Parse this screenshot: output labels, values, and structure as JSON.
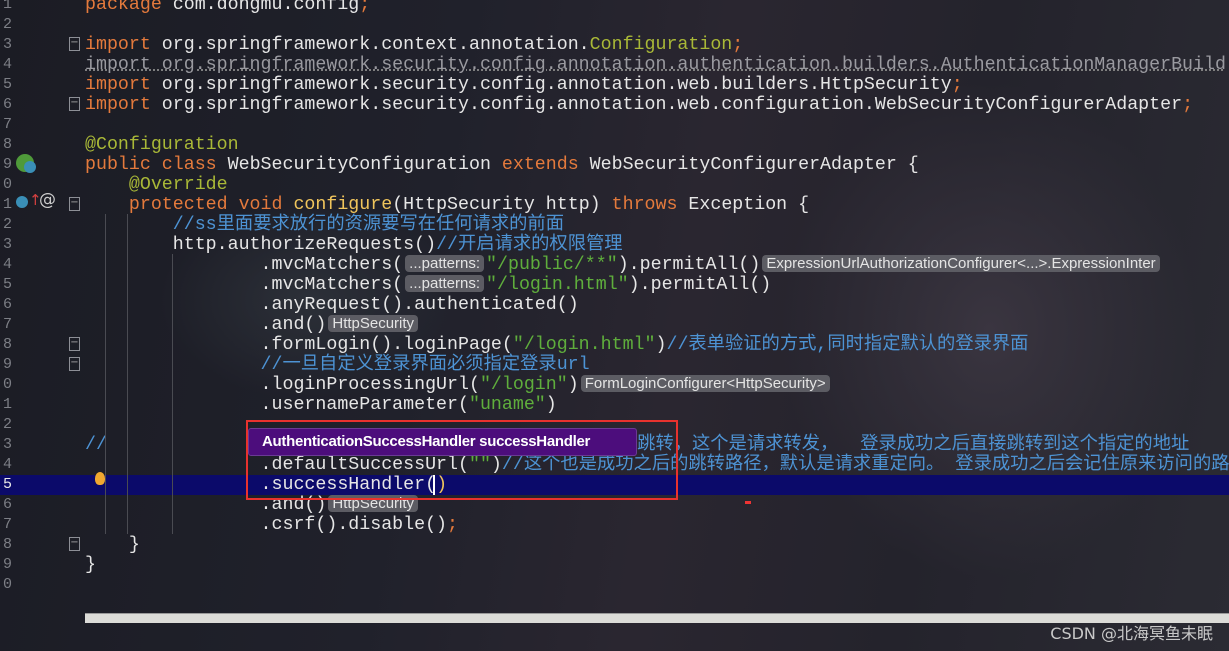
{
  "editor": {
    "current_line": 25,
    "lines": [
      {
        "n": "1",
        "t": [
          [
            "package ",
            "kw"
          ],
          [
            "com.dongmu.config",
            ""
          ],
          [
            ";",
            "kw"
          ]
        ]
      },
      {
        "n": "2",
        "t": []
      },
      {
        "n": "3",
        "t": [
          [
            "import ",
            "kw"
          ],
          [
            "org.springframework.context.annotation.",
            ""
          ],
          [
            "Configuration",
            "ann"
          ],
          [
            ";",
            "kw"
          ]
        ]
      },
      {
        "n": "4",
        "t": [
          [
            "import org.springframework.security.config.annotation.authentication.builders.AuthenticationManagerBuild",
            "dim"
          ]
        ]
      },
      {
        "n": "5",
        "t": [
          [
            "import ",
            "kw"
          ],
          [
            "org.springframework.security.config.annotation.web.builders.HttpSecurity",
            ""
          ],
          [
            ";",
            "kw"
          ]
        ]
      },
      {
        "n": "6",
        "t": [
          [
            "import ",
            "kw"
          ],
          [
            "org.springframework.security.config.annotation.web.configuration.WebSecurityConfigurerAdapter",
            ""
          ],
          [
            ";",
            "kw"
          ]
        ]
      },
      {
        "n": "7",
        "t": []
      },
      {
        "n": "8",
        "t": [
          [
            "@Configuration",
            "ann"
          ]
        ]
      },
      {
        "n": "9",
        "t": [
          [
            "public class ",
            "kw"
          ],
          [
            "WebSecurityConfiguration ",
            ""
          ],
          [
            "extends ",
            "kw"
          ],
          [
            "WebSecurityConfigurerAdapter {",
            ""
          ]
        ]
      },
      {
        "n": "0",
        "t": [
          [
            "    @Override",
            "ann"
          ]
        ]
      },
      {
        "n": "1",
        "t": [
          [
            "    protected void ",
            "kw"
          ],
          [
            "configure",
            "fn"
          ],
          [
            "(HttpSecurity http) ",
            ""
          ],
          [
            "throws ",
            "kw"
          ],
          [
            "Exception {",
            ""
          ]
        ]
      },
      {
        "n": "2",
        "t": [
          [
            "        //ss里面要求放行的资源要写在任何请求的前面",
            "cmt"
          ]
        ]
      },
      {
        "n": "3",
        "t": [
          [
            "        http.authorizeRequests()",
            ""
          ],
          [
            "//开启请求的权限管理",
            "cmt"
          ]
        ]
      },
      {
        "n": "4",
        "t": [
          [
            "                .mvcMatchers(",
            ""
          ],
          [
            "...patterns:",
            "hint"
          ],
          [
            "\"/public/**\"",
            "str"
          ],
          [
            ").permitAll()",
            ""
          ],
          [
            "ExpressionUrlAuthorizationConfigurer<...>.ExpressionInter",
            "hint"
          ]
        ]
      },
      {
        "n": "5",
        "t": [
          [
            "                .mvcMatchers(",
            ""
          ],
          [
            "...patterns:",
            "hint"
          ],
          [
            "\"/login.html\"",
            "str"
          ],
          [
            ").permitAll()",
            ""
          ]
        ]
      },
      {
        "n": "6",
        "t": [
          [
            "                .anyRequest().authenticated()",
            ""
          ]
        ]
      },
      {
        "n": "7",
        "t": [
          [
            "                .and()",
            ""
          ],
          [
            "HttpSecurity",
            "hint"
          ]
        ]
      },
      {
        "n": "8",
        "t": [
          [
            "                .formLogin().loginPage(",
            ""
          ],
          [
            "\"/login.html\"",
            "str"
          ],
          [
            ")",
            ""
          ],
          [
            "//表单验证的方式,同时指定默认的登录界面",
            "cmt"
          ]
        ]
      },
      {
        "n": "9",
        "t": [
          [
            "                //一旦自定义登录界面必须指定登录url",
            "cmt"
          ]
        ]
      },
      {
        "n": "0",
        "t": [
          [
            "                .loginProcessingUrl(",
            ""
          ],
          [
            "\"/login\"",
            "str"
          ],
          [
            ")",
            ""
          ],
          [
            "FormLoginConfigurer<HttpSecurity>",
            "hint"
          ]
        ]
      },
      {
        "n": "1",
        "t": [
          [
            "                .usernameParameter(",
            ""
          ],
          [
            "\"uname\"",
            "str"
          ],
          [
            ")",
            ""
          ]
        ]
      },
      {
        "n": "2",
        "t": []
      },
      {
        "n": "3",
        "t": [
          [
            "//",
            "cmt"
          ],
          [
            "                                        成功之后的跳转，这个是请求转发，  登录成功之后直接跳转到这个指定的地址",
            "cmt"
          ]
        ]
      },
      {
        "n": "4",
        "t": [
          [
            "                .defaultSuccessUrl(",
            ""
          ],
          [
            "\"\"",
            "str"
          ],
          [
            ")",
            ""
          ],
          [
            "//这个也是成功之后的跳转路径，默认是请求重定向。 登录成功之后会记住原来访问的路径",
            "cmt"
          ]
        ]
      },
      {
        "n": "5",
        "t": [
          [
            "                .successHandler(",
            ""
          ],
          [
            ")",
            "fn"
          ]
        ]
      },
      {
        "n": "6",
        "t": [
          [
            "                .and()",
            ""
          ],
          [
            "HttpSecurity",
            "hint"
          ]
        ]
      },
      {
        "n": "7",
        "t": [
          [
            "                .csrf().disable()",
            ""
          ],
          [
            ";",
            "kw"
          ]
        ]
      },
      {
        "n": "8",
        "t": [
          [
            "    }",
            ""
          ]
        ]
      },
      {
        "n": "9",
        "t": [
          [
            "}",
            ""
          ]
        ]
      },
      {
        "n": "0",
        "t": []
      }
    ]
  },
  "tooltip": {
    "text": "AuthenticationSuccessHandler successHandler"
  },
  "gutter_icons": {
    "line9": "spring-bean-icon",
    "line11_a": "override-method-icon",
    "line11_b": "at-annotation-icon",
    "line25": "lightbulb-intention-icon"
  },
  "watermark": "CSDN @北海冥鱼未眠",
  "colors": {
    "keyword": "#e47a3c",
    "annotation": "#a9b837",
    "string": "#5fae3c",
    "comment": "#4d93d4",
    "current_line": "#0b0a6a",
    "tooltip": "#4c0d7c",
    "highlight_box": "#e8322e"
  }
}
